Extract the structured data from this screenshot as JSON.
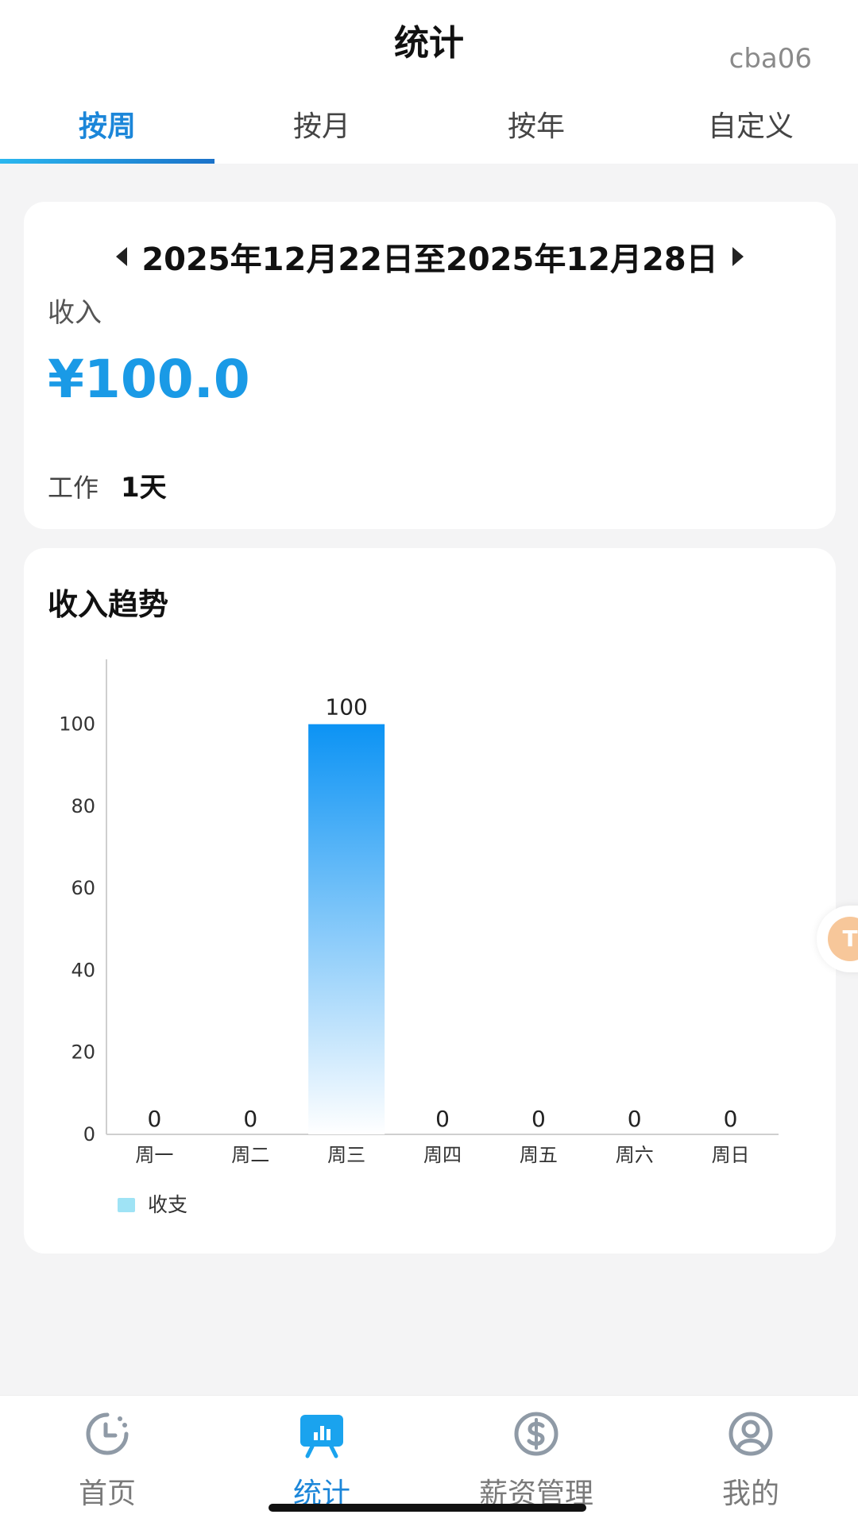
{
  "header": {
    "title": "统计",
    "user_id": "cba06"
  },
  "tabs": [
    {
      "label": "按周",
      "active": true
    },
    {
      "label": "按月",
      "active": false
    },
    {
      "label": "按年",
      "active": false
    },
    {
      "label": "自定义",
      "active": false
    }
  ],
  "summary": {
    "date_range": "2025年12月22日至2025年12月28日",
    "income_label": "收入",
    "income_value": "¥100.0",
    "work_label": "工作",
    "work_value": "1天"
  },
  "trend": {
    "title": "收入趋势",
    "legend_label": "收支"
  },
  "chart_data": {
    "type": "bar",
    "categories": [
      "周一",
      "周二",
      "周三",
      "周四",
      "周五",
      "周六",
      "周日"
    ],
    "series": [
      {
        "name": "收支",
        "values": [
          0,
          0,
          100,
          0,
          0,
          0,
          0
        ]
      }
    ],
    "ylim": [
      0,
      110
    ],
    "yticks": [
      0,
      20,
      40,
      60,
      80,
      100
    ],
    "legend_position": "bottom-left",
    "grid": false
  },
  "float_badge": {
    "text": "T"
  },
  "bottom_nav": [
    {
      "label": "首页",
      "icon": "clock-icon",
      "active": false
    },
    {
      "label": "统计",
      "icon": "chart-board-icon",
      "active": true
    },
    {
      "label": "薪资管理",
      "icon": "dollar-circle-icon",
      "active": false
    },
    {
      "label": "我的",
      "icon": "user-circle-icon",
      "active": false
    }
  ],
  "colors": {
    "accent": "#1b86d9",
    "income": "#1a9ae6",
    "bar_top": "#0c93f4",
    "bar_bottom": "#ffffff",
    "legend": "#9fe3f5"
  }
}
